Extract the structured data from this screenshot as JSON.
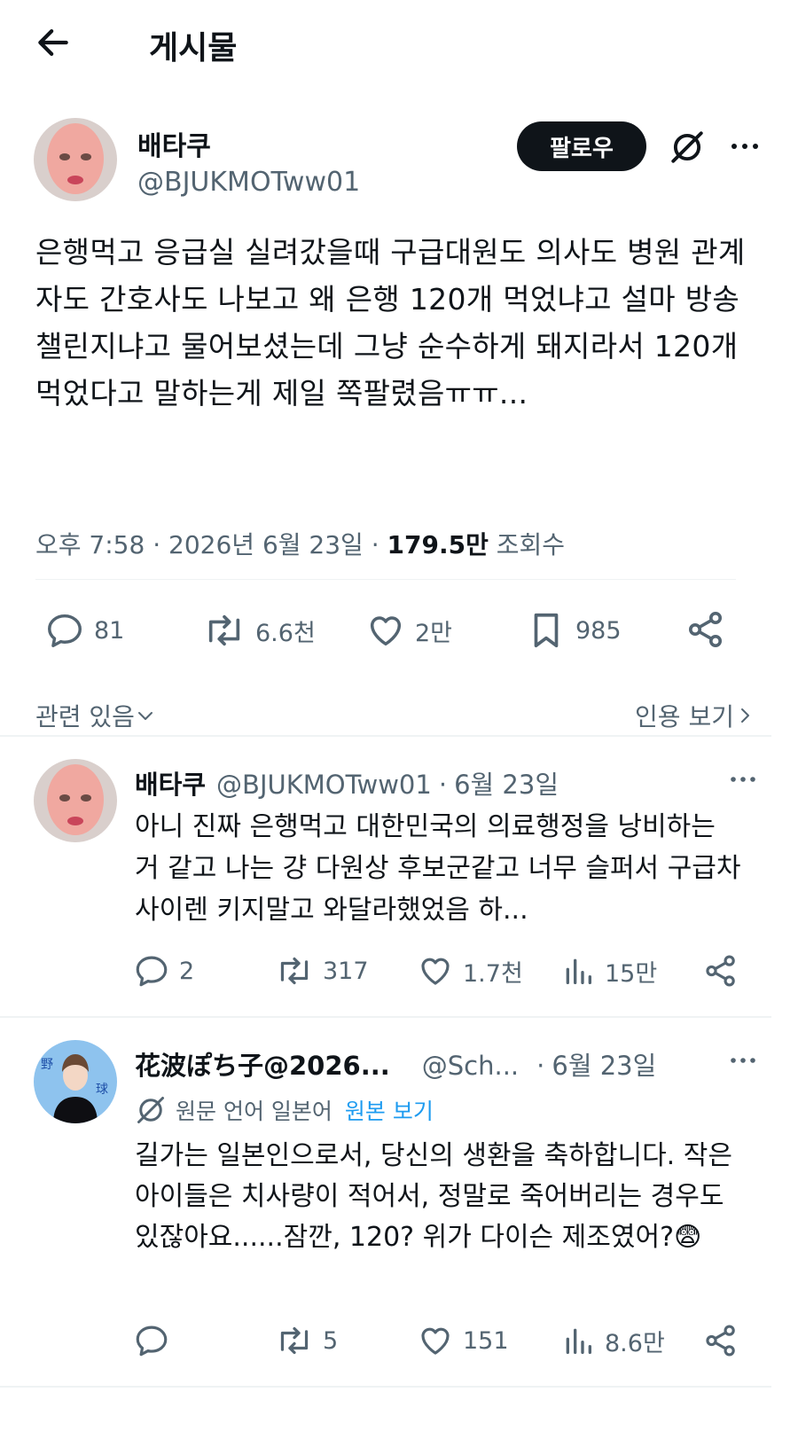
{
  "header": {
    "title": "게시물"
  },
  "main_post": {
    "name": "배타쿠",
    "handle": "@BJUKMOTww01",
    "follow_label": "팔로우",
    "text": "은행먹고 응급실 실려갔을때 구급대원도 의사도 병원 관계자도 간호사도 나보고 왜 은행 120개 먹었냐고 설마 방송 챌린지냐고 물어보셨는데 그냥 순수하게 돼지라서 120개 먹었다고 말하는게 제일 쪽팔렸음ㅠㅠ...",
    "time": "오후 7:58",
    "date": "2026년 6월 23일",
    "views_count": "179.5만",
    "views_label": "조회수",
    "replies": "81",
    "reposts": "6.6천",
    "likes": "2만",
    "bookmarks": "985",
    "related_label": "관련 있음",
    "quotes_label": "인용 보기"
  },
  "replies": [
    {
      "name": "배타쿠",
      "handle": "@BJUKMOTww01",
      "date": "6월 23일",
      "text": "아니 진짜 은행먹고 대한민국의 의료행정을 낭비하는 거 같고 나는 걍 다원상 후보군같고 너무 슬퍼서 구급차 사이렌 키지말고 와달라했었음 하...",
      "replies": "2",
      "reposts": "317",
      "likes": "1.7천",
      "views": "15만"
    },
    {
      "name": "花波ぽち子@2026...",
      "handle": "@Sch...",
      "date": "6월 23일",
      "translate_label": "원문 언어 일본어",
      "translate_link": "원본 보기",
      "avatar_text_1": "野",
      "avatar_text_2": "球",
      "text": "길가는 일본인으로서, 당신의 생환을 축하합니다. 작은 아이들은 치사량이 적어서, 정말로 죽어버리는 경우도 있잖아요......잠깐, 120? 위가 다이슨 제조였어?😨",
      "replies": "",
      "reposts": "5",
      "likes": "151",
      "views": "8.6만"
    }
  ]
}
